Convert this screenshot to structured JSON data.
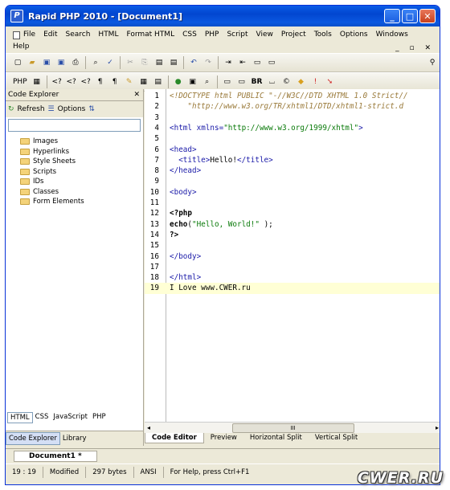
{
  "window": {
    "title": "Rapid PHP 2010 - [Document1]",
    "app_icon": "P"
  },
  "menu": {
    "items": [
      "File",
      "Edit",
      "Search",
      "HTML",
      "Format HTML",
      "CSS",
      "PHP",
      "Script",
      "View",
      "Project",
      "Tools",
      "Options",
      "Windows",
      "Help"
    ],
    "mdi_controls": "_ ▫ ✕"
  },
  "toolbar2": {
    "php_label": "PHP",
    "br_label": "BR"
  },
  "code_explorer": {
    "title": "Code Explorer",
    "refresh_label": "Refresh",
    "options_label": "Options",
    "tree": [
      "Images",
      "Hyperlinks",
      "Style Sheets",
      "Scripts",
      "IDs",
      "Classes",
      "Form Elements"
    ],
    "lang_tabs": [
      "HTML",
      "CSS",
      "JavaScript",
      "PHP"
    ],
    "view_tabs": [
      "Code Explorer",
      "Library"
    ]
  },
  "editor": {
    "line_numbers": [
      "1",
      "2",
      "3",
      "4",
      "5",
      "6",
      "7",
      "8",
      "9",
      "10",
      "11",
      "12",
      "13",
      "14",
      "15",
      "16",
      "17",
      "18",
      "19"
    ],
    "tabs": [
      "Code Editor",
      "Preview",
      "Horizontal Split",
      "Vertical Split"
    ],
    "scroll_thumb": "III"
  },
  "code": {
    "l1": "<!DOCTYPE html PUBLIC \"-//W3C//DTD XHTML 1.0 Strict//",
    "l2": "    \"http://www.w3.org/TR/xhtml1/DTD/xhtml1-strict.d",
    "l4_tag": "<html ",
    "l4_attr": "xmlns=",
    "l4_val": "\"http://www.w3.org/1999/xhtml\"",
    "l4_close": ">",
    "l6": "<head>",
    "l7_open": "  <title>",
    "l7_text": "Hello!",
    "l7_close": "</title>",
    "l8": "</head>",
    "l10": "<body>",
    "l12": "<?php",
    "l13_fn": "echo",
    "l13_open": "(",
    "l13_str": "\"Hello, World!\"",
    "l13_close": " );",
    "l14": "?>",
    "l16": "</body>",
    "l18": "</html>",
    "l19": "I Love www.CWER.ru"
  },
  "document_tab": "Document1 *",
  "status": {
    "position": "19 : 19",
    "state": "Modified",
    "size": "297 bytes",
    "encoding": "ANSI",
    "help": "For Help, press Ctrl+F1"
  },
  "watermark": "CWER.RU"
}
